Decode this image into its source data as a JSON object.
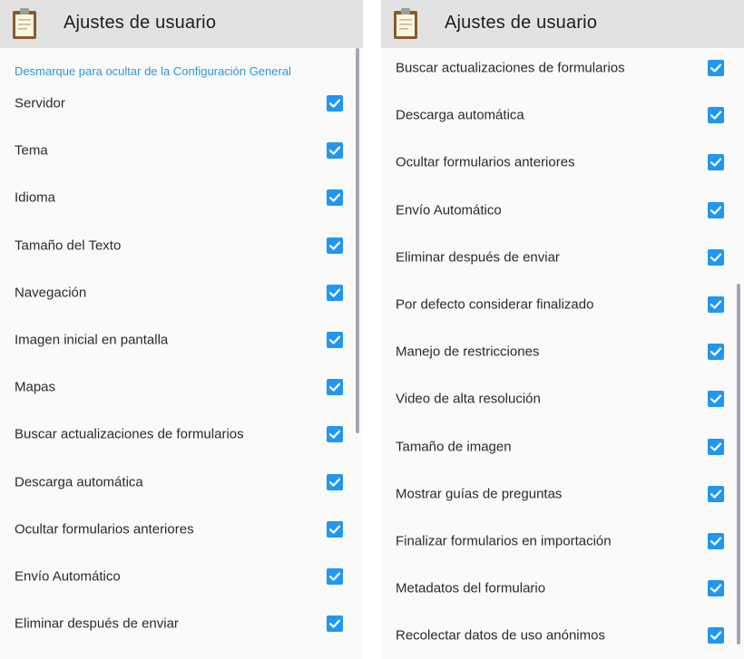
{
  "app": {
    "title": "Ajustes de usuario",
    "icon": "clipboard-icon",
    "accent_color": "#2196f3",
    "appbar_color": "#e2e2e2",
    "hint_color": "#2f95d6"
  },
  "left_panel": {
    "hint": "Desmarque para ocultar de la Configuración General",
    "items": [
      {
        "label": "Servidor",
        "checked": true
      },
      {
        "label": "Tema",
        "checked": true
      },
      {
        "label": "Idioma",
        "checked": true
      },
      {
        "label": "Tamaño del Texto",
        "checked": true
      },
      {
        "label": "Navegación",
        "checked": true
      },
      {
        "label": "Imagen inicial en pantalla",
        "checked": true
      },
      {
        "label": "Mapas",
        "checked": true
      },
      {
        "label": "Buscar actualizaciones de formularios",
        "checked": true
      },
      {
        "label": "Descarga automática",
        "checked": true
      },
      {
        "label": "Ocultar formularios anteriores",
        "checked": true
      },
      {
        "label": "Envío Automático",
        "checked": true
      },
      {
        "label": "Eliminar después de enviar",
        "checked": true
      }
    ]
  },
  "right_panel": {
    "items": [
      {
        "label": "Buscar actualizaciones de formularios",
        "checked": true
      },
      {
        "label": "Descarga automática",
        "checked": true
      },
      {
        "label": "Ocultar formularios anteriores",
        "checked": true
      },
      {
        "label": "Envío Automático",
        "checked": true
      },
      {
        "label": "Eliminar después de enviar",
        "checked": true
      },
      {
        "label": "Por defecto considerar finalizado",
        "checked": true
      },
      {
        "label": "Manejo de restricciones",
        "checked": true
      },
      {
        "label": "Video de alta resolución",
        "checked": true
      },
      {
        "label": "Tamaño de imagen",
        "checked": true
      },
      {
        "label": "Mostrar guías de preguntas",
        "checked": true
      },
      {
        "label": "Finalizar formularios en importación",
        "checked": true
      },
      {
        "label": "Metadatos del formulario",
        "checked": true
      },
      {
        "label": "Recolectar datos de uso anónimos",
        "checked": true
      }
    ]
  }
}
